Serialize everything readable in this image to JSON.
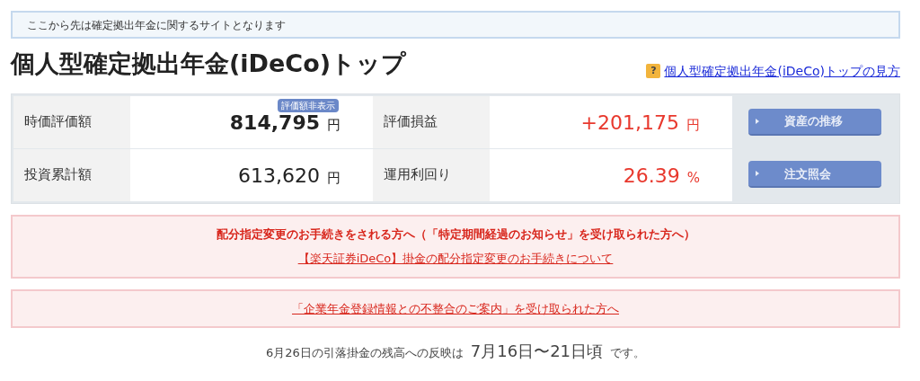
{
  "notice": "ここから先は確定拠出年金に関するサイトとなります",
  "title": "個人型確定拠出年金(iDeCo)トップ",
  "help_link": {
    "icon": "?",
    "label": "個人型確定拠出年金(iDeCo)トップの見方"
  },
  "summary": [
    {
      "label": "時価評価額",
      "value": "814,795",
      "unit": "円",
      "kind": "total",
      "badge": "評価額非表示"
    },
    {
      "label": "評価損益",
      "value": "+201,175",
      "unit": "円",
      "kind": "gain"
    },
    {
      "label": "投資累計額",
      "value": "613,620",
      "unit": "円",
      "kind": "plain"
    },
    {
      "label": "運用利回り",
      "value": "26.39",
      "unit": "%",
      "kind": "gain"
    }
  ],
  "buttons": [
    "資産の推移",
    "注文照会"
  ],
  "alerts": [
    {
      "heading": "配分指定変更のお手続きをされる方へ（「特定期間経過のお知らせ」を受け取られた方へ）",
      "link": "【楽天証券iDeCo】掛金の配分指定変更のお手続きについて"
    },
    {
      "link": "「企業年金登録情報との不整合のご案内」を受け取られた方へ"
    }
  ],
  "footer": {
    "prefix": "6月26日の引落掛金の残高への反映は",
    "highlight": "7月16日〜21日頃",
    "suffix": "です。"
  }
}
